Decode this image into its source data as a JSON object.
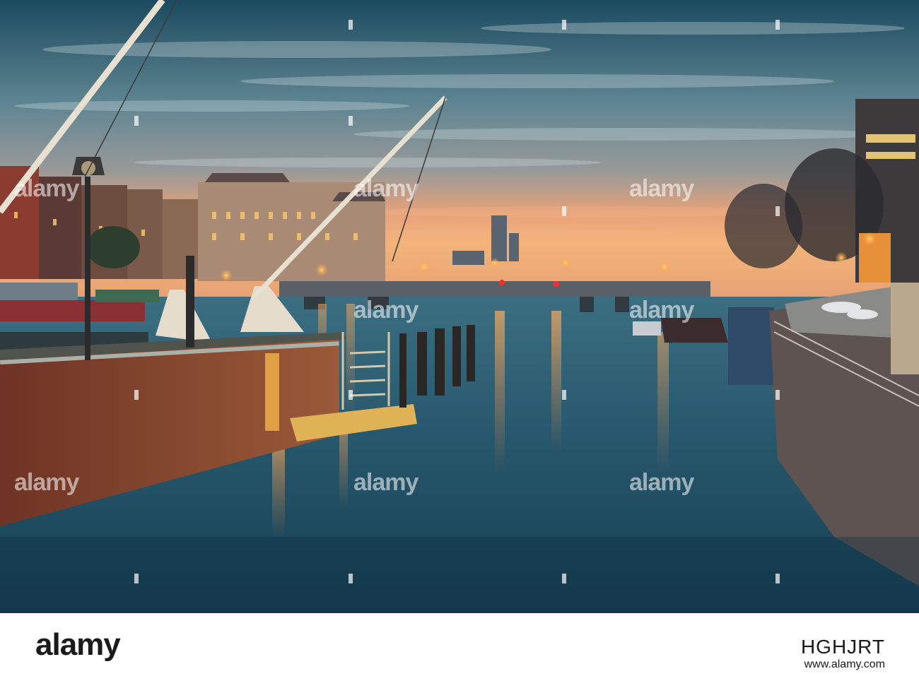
{
  "watermark": {
    "brand_text": "alamy",
    "mark_color": "#ffffff"
  },
  "footer": {
    "brand": "alamy",
    "image_id": "HGHJRT",
    "url": "www.alamy.com"
  },
  "colors": {
    "sky_top": "#1d4e63",
    "sky_mid": "#6a8a94",
    "sunset_glow": "#f0a46a",
    "water": "#1f4c60",
    "brick": "#7a3b2a",
    "lamp_glow": "#ffb84a"
  }
}
